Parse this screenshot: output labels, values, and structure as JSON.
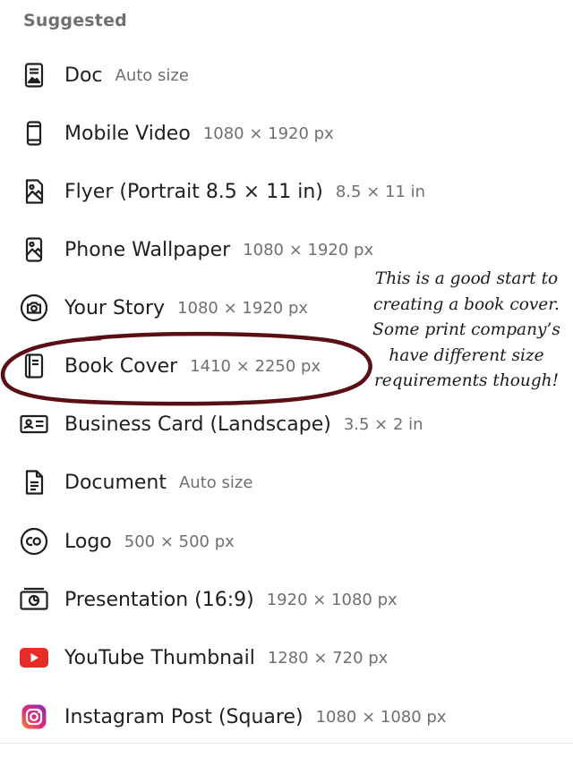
{
  "section_title": "Suggested",
  "items": [
    {
      "name": "Doc",
      "size": "Auto size",
      "icon": "doc-icon"
    },
    {
      "name": "Mobile Video",
      "size": "1080 × 1920 px",
      "icon": "mobile-video-icon"
    },
    {
      "name": "Flyer (Portrait 8.5 × 11 in)",
      "size": "8.5 × 11 in",
      "icon": "flyer-icon"
    },
    {
      "name": "Phone Wallpaper",
      "size": "1080 × 1920 px",
      "icon": "phone-wallpaper-icon"
    },
    {
      "name": "Your Story",
      "size": "1080 × 1920 px",
      "icon": "camera-icon"
    },
    {
      "name": "Book Cover",
      "size": "1410 × 2250 px",
      "icon": "book-cover-icon"
    },
    {
      "name": "Business Card (Landscape)",
      "size": "3.5 × 2 in",
      "icon": "business-card-icon"
    },
    {
      "name": "Document",
      "size": "Auto size",
      "icon": "document-icon"
    },
    {
      "name": "Logo",
      "size": "500 × 500 px",
      "icon": "logo-icon"
    },
    {
      "name": "Presentation (16:9)",
      "size": "1920 × 1080 px",
      "icon": "presentation-icon"
    },
    {
      "name": "YouTube Thumbnail",
      "size": "1280 × 720 px",
      "icon": "youtube-icon"
    },
    {
      "name": "Instagram Post (Square)",
      "size": "1080 × 1080 px",
      "icon": "instagram-icon"
    }
  ],
  "annotation": {
    "lines": [
      "This is a good start to",
      "creating a book cover.",
      "Some print company’s",
      "have different size",
      "requirements though!"
    ]
  },
  "colors": {
    "text": "#1f1f1f",
    "muted": "#6f6f6f",
    "marker": "#5a0f14",
    "youtube": "#e52d27",
    "instagram": "#d6246e"
  }
}
